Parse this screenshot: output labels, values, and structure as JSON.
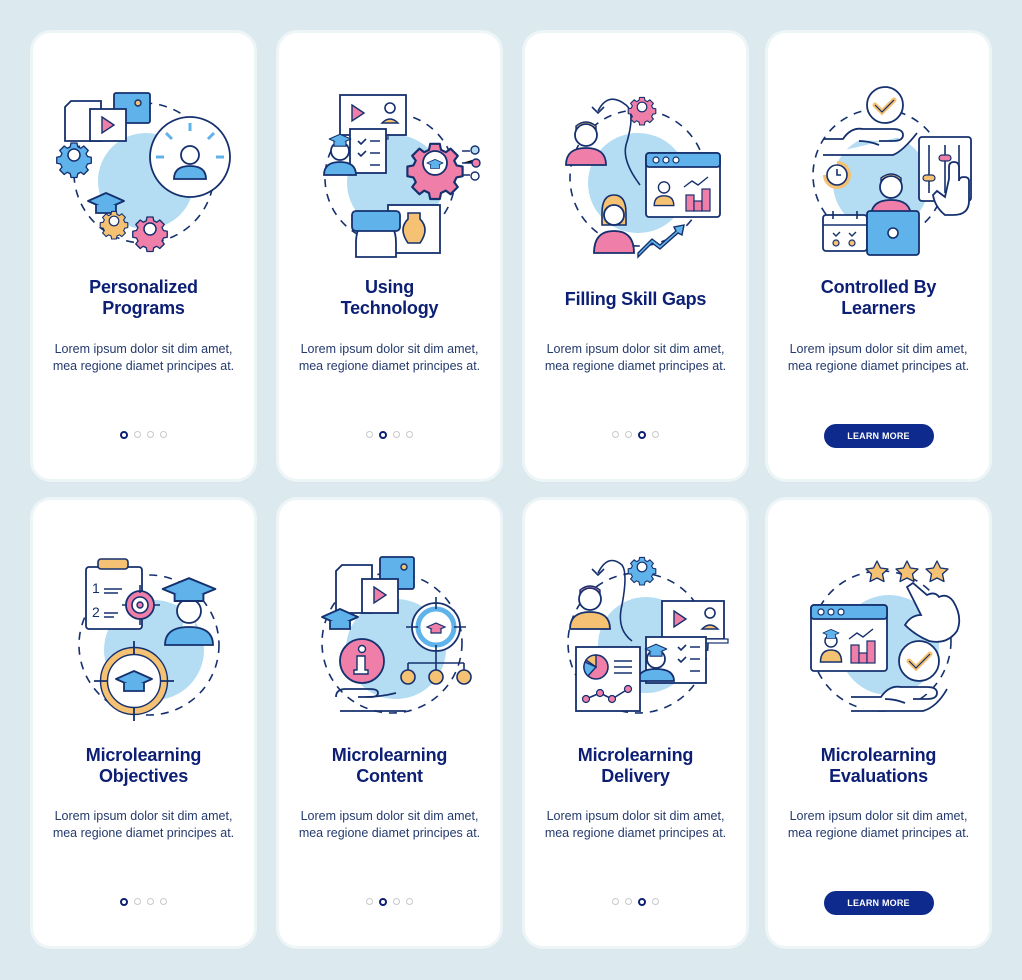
{
  "colors": {
    "background": "#dce9ee",
    "card": "#ffffff",
    "title": "#0c1f74",
    "button": "#0d2a8c",
    "icon_blue": "#5fb3ea",
    "icon_light_blue": "#b4ddf3",
    "icon_pink": "#ef7fa8",
    "icon_orange": "#f5c172",
    "icon_outline": "#15306e"
  },
  "cards": [
    {
      "title_line1": "Personalized",
      "title_line2": "Programs",
      "description": "Lorem ipsum dolor sit dim amet, mea regione diamet principes at.",
      "illustration": "personalized-programs-illustration",
      "pagination": {
        "total": 4,
        "active": 1
      }
    },
    {
      "title_line1": "Using",
      "title_line2": "Technology",
      "description": "Lorem ipsum dolor sit dim amet, mea regione diamet principes at.",
      "illustration": "using-technology-illustration",
      "pagination": {
        "total": 4,
        "active": 2
      }
    },
    {
      "title_line1": "Filling Skill Gaps",
      "title_line2": "",
      "description": "Lorem ipsum dolor sit dim amet, mea regione diamet principes at.",
      "illustration": "filling-skill-gaps-illustration",
      "pagination": {
        "total": 4,
        "active": 3
      }
    },
    {
      "title_line1": "Controlled By",
      "title_line2": "Learners",
      "description": "Lorem ipsum dolor sit dim amet, mea regione diamet principes at.",
      "illustration": "controlled-by-learners-illustration",
      "button_label": "LEARN MORE"
    },
    {
      "title_line1": "Microlearning",
      "title_line2": "Objectives",
      "description": "Lorem ipsum dolor sit dim amet, mea regione diamet principes at.",
      "illustration": "microlearning-objectives-illustration",
      "pagination": {
        "total": 4,
        "active": 1
      }
    },
    {
      "title_line1": "Microlearning",
      "title_line2": "Content",
      "description": "Lorem ipsum dolor sit dim amet, mea regione diamet principes at.",
      "illustration": "microlearning-content-illustration",
      "pagination": {
        "total": 4,
        "active": 2
      }
    },
    {
      "title_line1": "Microlearning",
      "title_line2": "Delivery",
      "description": "Lorem ipsum dolor sit dim amet, mea regione diamet principes at.",
      "illustration": "microlearning-delivery-illustration",
      "pagination": {
        "total": 4,
        "active": 3
      }
    },
    {
      "title_line1": "Microlearning",
      "title_line2": "Evaluations",
      "description": "Lorem ipsum dolor sit dim amet, mea regione diamet principes at.",
      "illustration": "microlearning-evaluations-illustration",
      "button_label": "LEARN MORE"
    }
  ]
}
